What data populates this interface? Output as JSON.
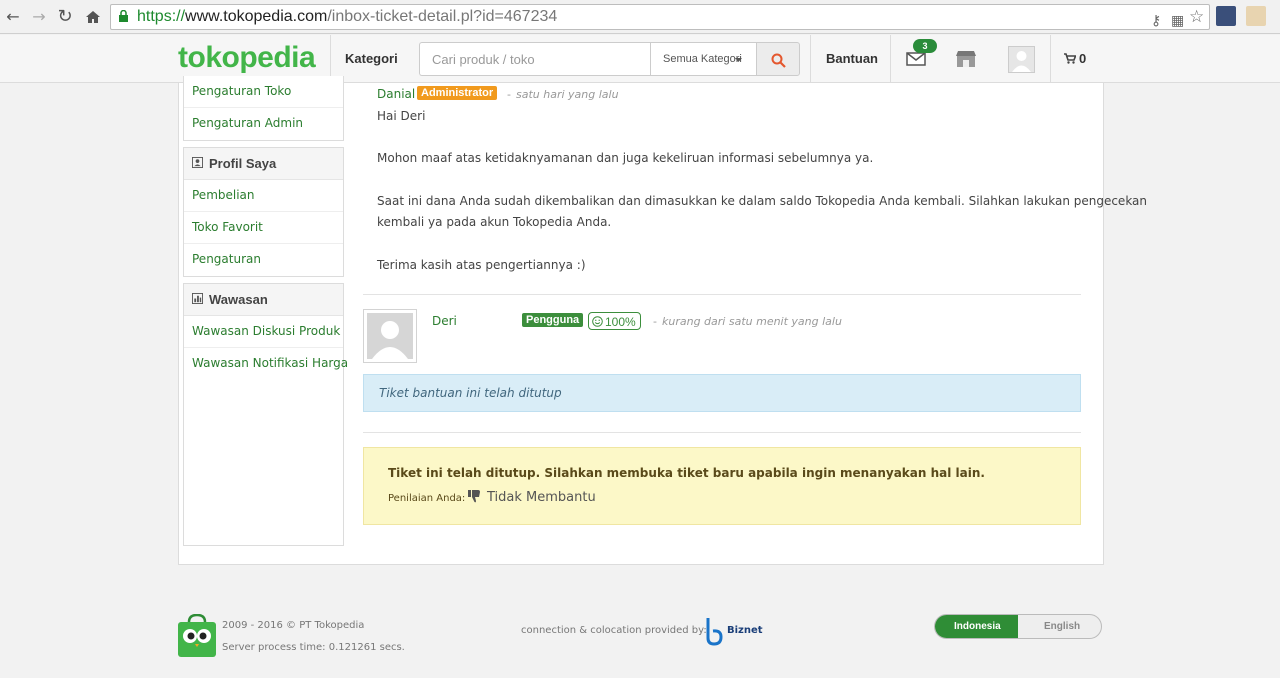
{
  "browser": {
    "url_scheme": "https://",
    "url_host": "www.tokopedia.com",
    "url_path": "/inbox-ticket-detail.pl?id=467234"
  },
  "header": {
    "logo": "tokopedia",
    "kategori": "Kategori",
    "search_placeholder": "Cari produk / toko",
    "search_category": "Semua Kategori",
    "bantuan": "Bantuan",
    "inbox_count": "3",
    "cart_count": "0"
  },
  "sidebar": {
    "top_items": [
      "Pengaturan Toko",
      "Pengaturan Admin"
    ],
    "groups": [
      {
        "title": "Profil Saya",
        "items": [
          "Pembelian",
          "Toko Favorit",
          "Pengaturan"
        ]
      },
      {
        "title": "Wawasan",
        "items": [
          "Wawasan Diskusi Produk",
          "Wawasan Notifikasi Harga"
        ]
      }
    ]
  },
  "ticket": {
    "admin_name": "Danial",
    "admin_badge": "Administrator",
    "admin_sep": "-",
    "admin_time": "satu hari yang lalu",
    "admin_message": [
      "Hai Deri",
      "Mohon maaf atas ketidaknyamanan dan juga kekeliruan informasi sebelumnya ya.",
      "Saat ini dana Anda sudah dikembalikan dan dimasukkan ke dalam saldo Tokopedia Anda kembali. Silahkan lakukan pengecekan",
      "kembali ya pada akun Tokopedia Anda.",
      "Terima kasih atas pengertiannya :)"
    ],
    "user_name": "Deri",
    "user_badge": "Pengguna",
    "user_reputation": "100%",
    "user_sep": "-",
    "user_time": "kurang dari satu menit yang lalu",
    "closed_info": "Tiket bantuan ini telah ditutup",
    "closed_warning": "Tiket ini telah ditutup. Silahkan membuka tiket baru apabila ingin menanyakan hal lain.",
    "rating_label": "Penilaian Anda:",
    "rating_value": "Tidak Membantu"
  },
  "footer": {
    "copyright": "2009 - 2016 © PT Tokopedia",
    "server_time": "Server process time: 0.121261 secs.",
    "connection": "connection & colocation provided by:",
    "provider": "Biznet",
    "lang_active": "Indonesia",
    "lang_other": "English"
  },
  "colors": {
    "brand_green": "#42b549",
    "link_green": "#2b7d2f",
    "admin_orange": "#f19a1d",
    "info_blue": "#d9edf7",
    "warning_yellow": "#fcf8c8"
  }
}
